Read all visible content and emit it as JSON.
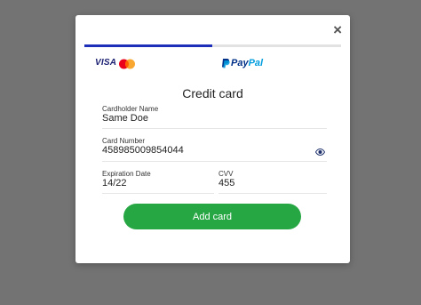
{
  "modal": {
    "close_label": "×",
    "title": "Credit card",
    "tabs": {
      "card": {
        "visa_label": "VISA",
        "icon": "mastercard-icon",
        "active": true
      },
      "paypal": {
        "pay": "Pay",
        "pal": "Pal",
        "icon": "paypal-icon",
        "active": false
      }
    },
    "fields": {
      "cardholder": {
        "label": "Cardholder Name",
        "value": "Same Doe"
      },
      "number": {
        "label": "Card Number",
        "value": "458985009854044",
        "icon": "eye-icon"
      },
      "expiry": {
        "label": "Expiration Date",
        "value": "14/22"
      },
      "cvv": {
        "label": "CVV",
        "value": "455"
      }
    },
    "submit_label": "Add card"
  },
  "colors": {
    "overlay": "#737373",
    "active_tab": "#1d2fb8",
    "button": "#27a744",
    "visa": "#1a1f71",
    "paypal_dark": "#003087",
    "paypal_light": "#009cde"
  }
}
